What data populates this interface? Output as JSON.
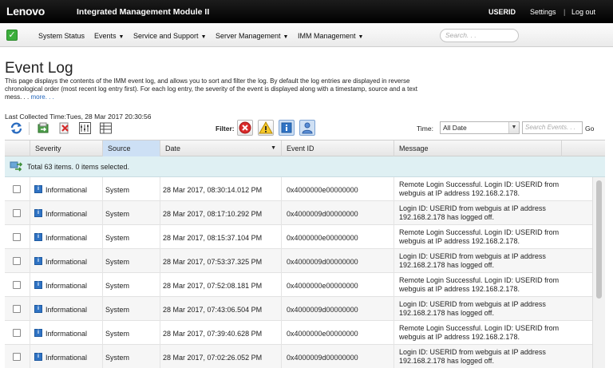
{
  "topbar": {
    "brand": "Lenovo",
    "module_title": "Integrated Management Module II",
    "user": "USERID",
    "settings": "Settings",
    "separator": "|",
    "logout": "Log out"
  },
  "nav": {
    "items": [
      {
        "label": "System Status",
        "caret": ""
      },
      {
        "label": "Events",
        "caret": "▼"
      },
      {
        "label": "Service and Support",
        "caret": "▼"
      },
      {
        "label": "Server Management",
        "caret": "▼"
      },
      {
        "label": "IMM Management",
        "caret": "▼"
      }
    ],
    "search_placeholder": "Search. . ."
  },
  "page": {
    "title": "Event Log",
    "description": "This page displays the contents of the IMM event log, and allows you to sort and filter the log. By default the log entries are displayed in reverse chronological order (most recent log entry first). For each log entry, the severity of the event is displayed along with a timestamp, source and a text mess. . .",
    "more": "more. . .",
    "last_collected": "Last Collected Time:Tues, 28 Mar 2017 20:30:56"
  },
  "toolbar": {
    "filter_label": "Filter:",
    "time_label": "Time:",
    "time_value": "All Date",
    "search_placeholder": "Search Events. . .",
    "go": "Go"
  },
  "table": {
    "headers": {
      "severity": "Severity",
      "source": "Source",
      "date": "Date",
      "date_sort": "▼",
      "event_id": "Event ID",
      "message": "Message"
    },
    "summary": "Total 63 items. 0 items selected.",
    "rows": [
      {
        "severity": "Informational",
        "source": "System",
        "date": "28 Mar 2017, 08:30:14.012 PM",
        "event_id": "0x4000000e00000000",
        "message": "Remote Login Successful. Login ID: USERID from webguis at IP address 192.168.2.178."
      },
      {
        "severity": "Informational",
        "source": "System",
        "date": "28 Mar 2017, 08:17:10.292 PM",
        "event_id": "0x4000009d00000000",
        "message": "Login ID: USERID from webguis at IP address 192.168.2.178 has logged off."
      },
      {
        "severity": "Informational",
        "source": "System",
        "date": "28 Mar 2017, 08:15:37.104 PM",
        "event_id": "0x4000000e00000000",
        "message": "Remote Login Successful. Login ID: USERID from webguis at IP address 192.168.2.178."
      },
      {
        "severity": "Informational",
        "source": "System",
        "date": "28 Mar 2017, 07:53:37.325 PM",
        "event_id": "0x4000009d00000000",
        "message": "Login ID: USERID from webguis at IP address 192.168.2.178 has logged off."
      },
      {
        "severity": "Informational",
        "source": "System",
        "date": "28 Mar 2017, 07:52:08.181 PM",
        "event_id": "0x4000000e00000000",
        "message": "Remote Login Successful. Login ID: USERID from webguis at IP address 192.168.2.178."
      },
      {
        "severity": "Informational",
        "source": "System",
        "date": "28 Mar 2017, 07:43:06.504 PM",
        "event_id": "0x4000009d00000000",
        "message": "Login ID: USERID from webguis at IP address 192.168.2.178 has logged off."
      },
      {
        "severity": "Informational",
        "source": "System",
        "date": "28 Mar 2017, 07:39:40.628 PM",
        "event_id": "0x4000000e00000000",
        "message": "Remote Login Successful. Login ID: USERID from webguis at IP address 192.168.2.178."
      },
      {
        "severity": "Informational",
        "source": "System",
        "date": "28 Mar 2017, 07:02:26.052 PM",
        "event_id": "0x4000009d00000000",
        "message": "Login ID: USERID from webguis at IP address 192.168.2.178 has logged off."
      }
    ]
  },
  "colors": {
    "brand_red": "#e2231a",
    "status_green": "#3cae3c",
    "info_blue": "#2f73c4",
    "sorted_header": "#cde0f5",
    "summary_bg": "#dff0f3"
  }
}
